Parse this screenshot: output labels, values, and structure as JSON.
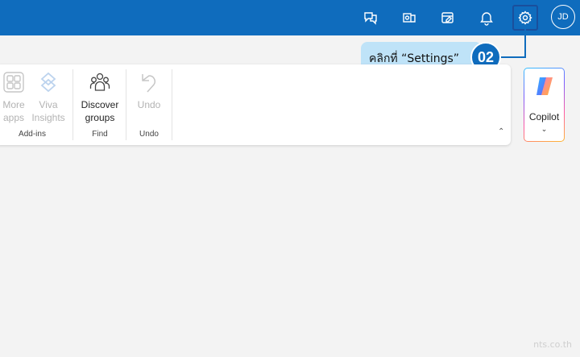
{
  "topbar": {
    "icons": [
      "feedback-icon",
      "outlook-icon",
      "tasks-icon",
      "bell-icon",
      "gear-icon"
    ],
    "avatar_initials": "JD"
  },
  "ribbon": {
    "addins": {
      "more_apps_line1": "More",
      "more_apps_line2": "apps",
      "viva_line1": "Viva",
      "viva_line2": "Insights",
      "group_label": "Add-ins"
    },
    "find": {
      "discover_line1": "Discover",
      "discover_line2": "groups",
      "group_label": "Find"
    },
    "undo": {
      "undo_label": "Undo",
      "group_label": "Undo"
    }
  },
  "copilot": {
    "label": "Copilot"
  },
  "callout": {
    "text": "คลิกที่ “Settings”",
    "step": "02"
  },
  "watermark": "nts.co.th"
}
